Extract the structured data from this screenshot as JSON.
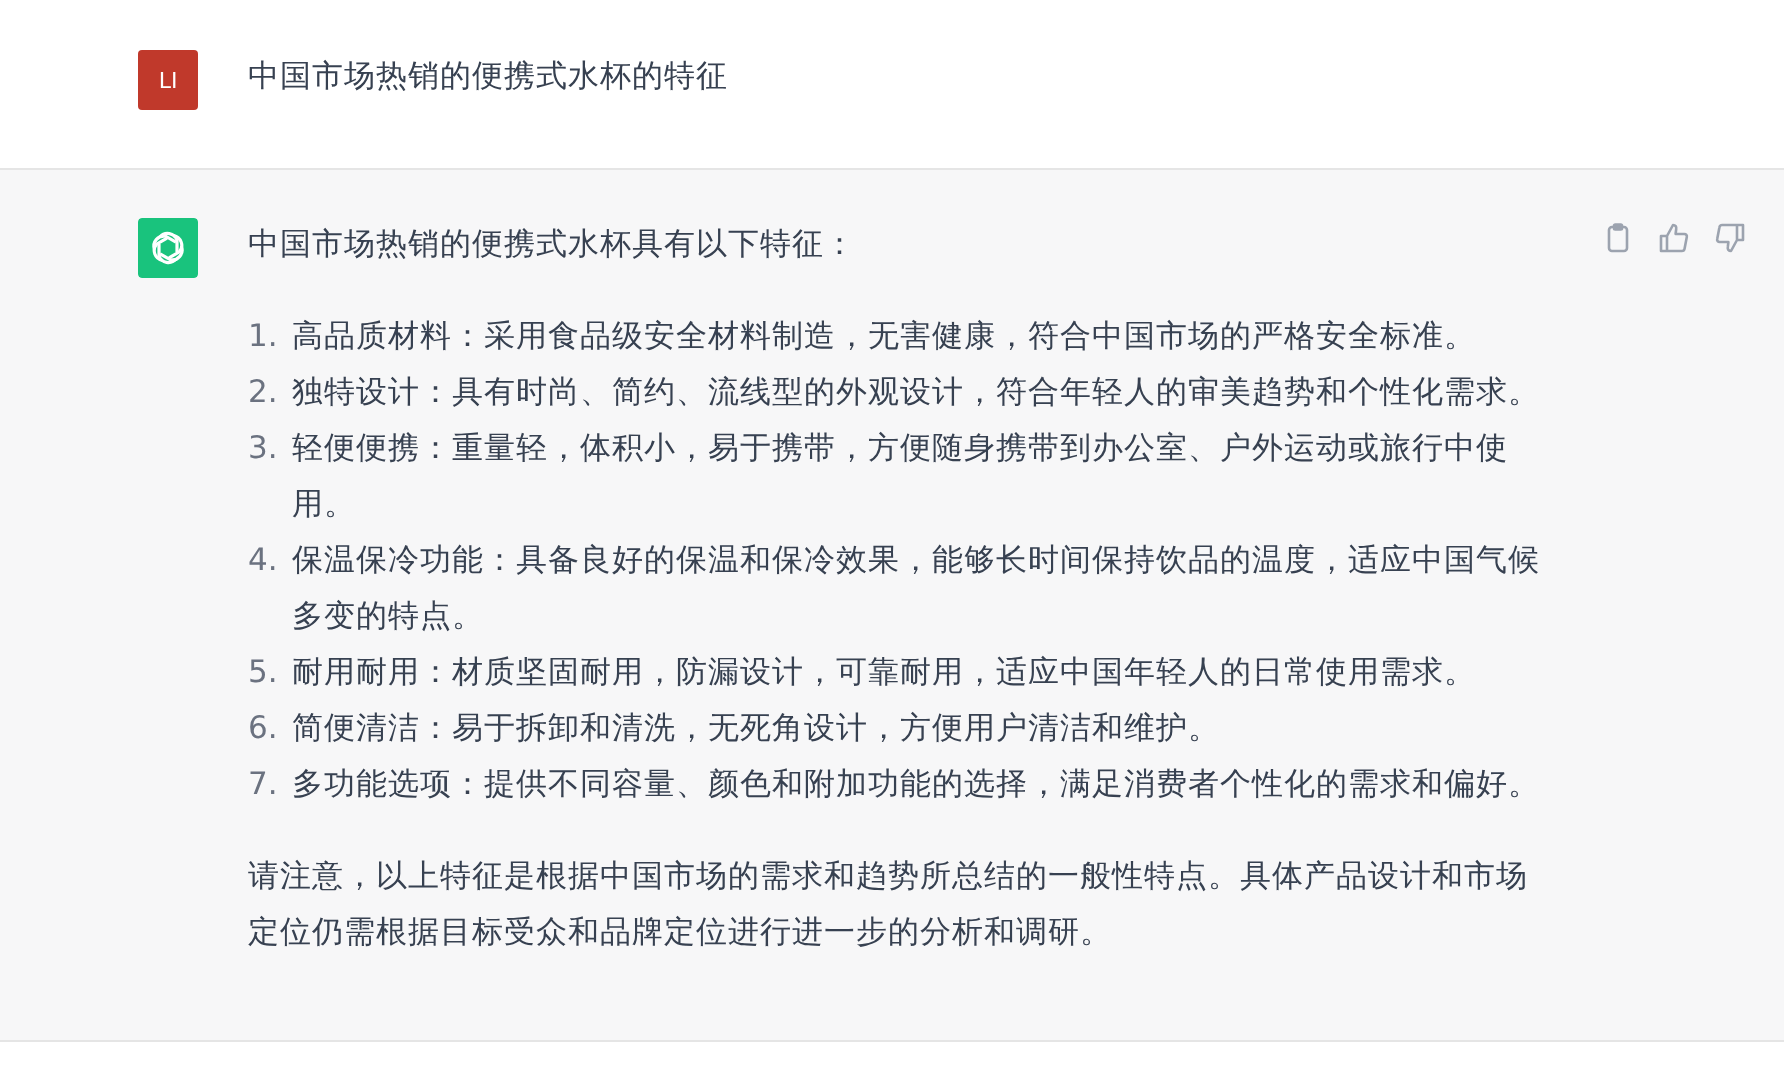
{
  "user_message": {
    "avatar": "LI",
    "text": "中国市场热销的便携式水杯的特征"
  },
  "assistant_message": {
    "intro": "中国市场热销的便携式水杯具有以下特征：",
    "items": [
      {
        "number": "1.",
        "text": "高品质材料：采用食品级安全材料制造，无害健康，符合中国市场的严格安全标准。"
      },
      {
        "number": "2.",
        "text": "独特设计：具有时尚、简约、流线型的外观设计，符合年轻人的审美趋势和个性化需求。"
      },
      {
        "number": "3.",
        "text": "轻便便携：重量轻，体积小，易于携带，方便随身携带到办公室、户外运动或旅行中使用。"
      },
      {
        "number": "4.",
        "text": "保温保冷功能：具备良好的保温和保冷效果，能够长时间保持饮品的温度，适应中国气候多变的特点。"
      },
      {
        "number": "5.",
        "text": "耐用耐用：材质坚固耐用，防漏设计，可靠耐用，适应中国年轻人的日常使用需求。"
      },
      {
        "number": "6.",
        "text": "简便清洁：易于拆卸和清洗，无死角设计，方便用户清洁和维护。"
      },
      {
        "number": "7.",
        "text": "多功能选项：提供不同容量、颜色和附加功能的选择，满足消费者个性化的需求和偏好。"
      }
    ],
    "note": "请注意，以上特征是根据中国市场的需求和趋势所总结的一般性特点。具体产品设计和市场定位仍需根据目标受众和品牌定位进行进一步的分析和调研。"
  }
}
